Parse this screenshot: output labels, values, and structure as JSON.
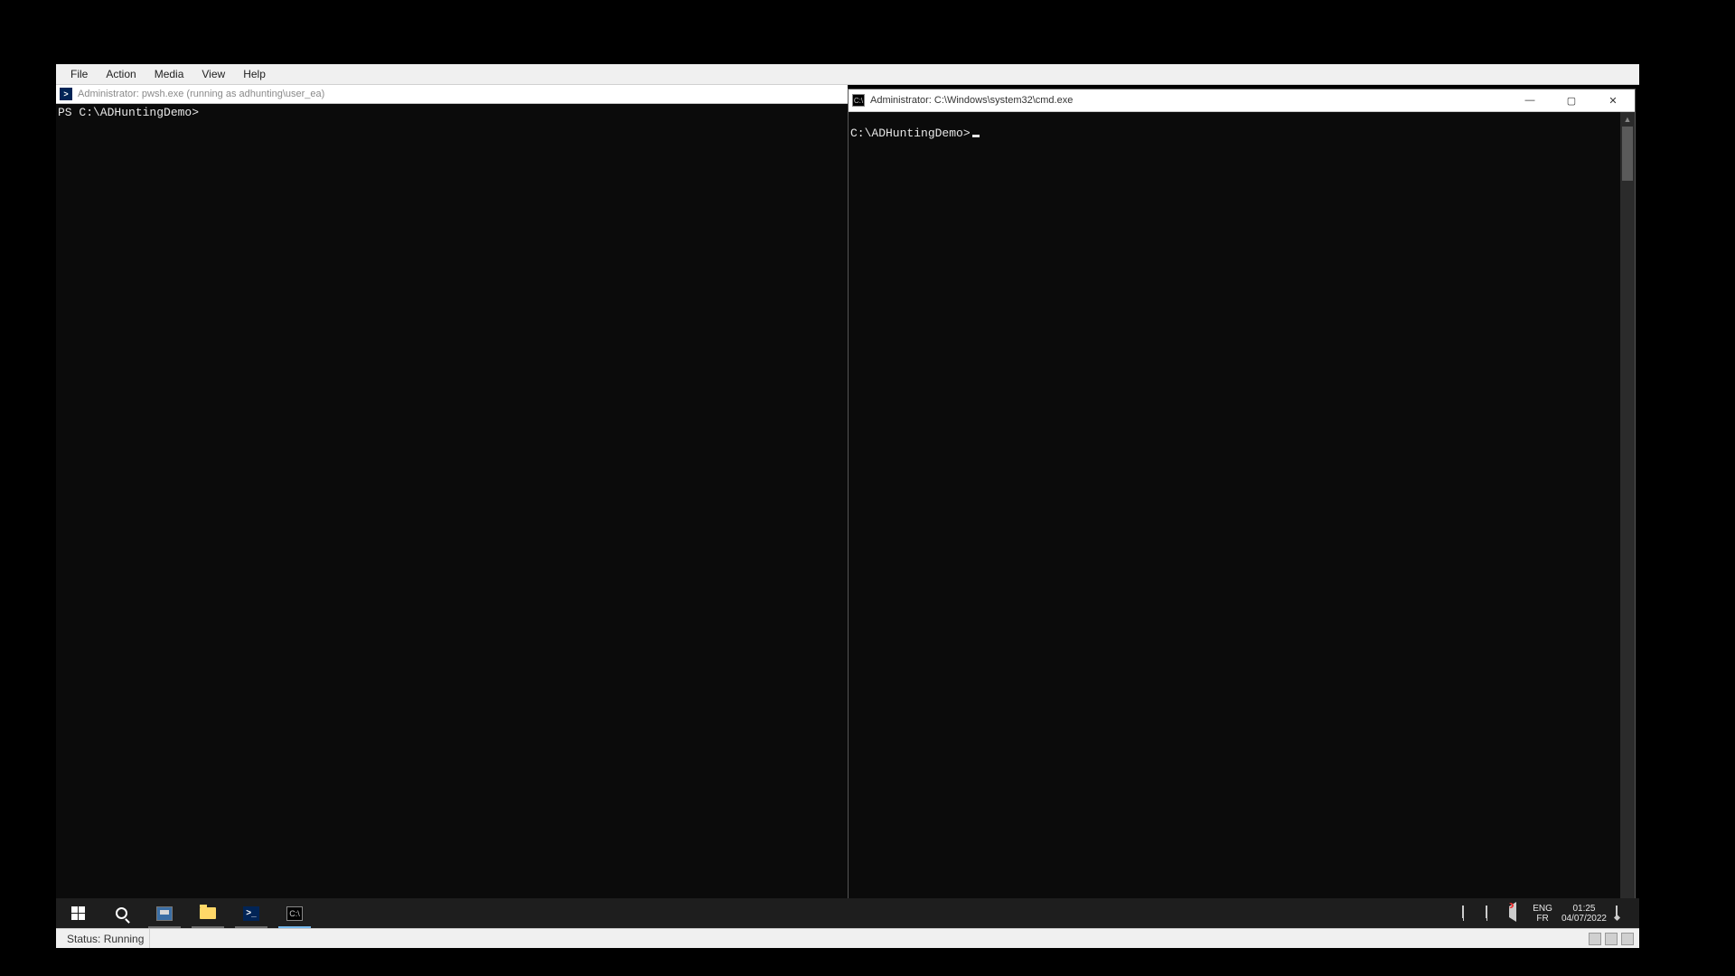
{
  "viewer": {
    "menu": [
      "File",
      "Action",
      "Media",
      "View",
      "Help"
    ],
    "status_label": "Status: Running"
  },
  "left_window": {
    "title": "Administrator: pwsh.exe (running as adhunting\\user_ea)",
    "prompt": "PS C:\\ADHuntingDemo>"
  },
  "right_window": {
    "title": "Administrator: C:\\Windows\\system32\\cmd.exe",
    "prompt": "C:\\ADHuntingDemo>",
    "controls": {
      "minimize": "—",
      "maximize": "▢",
      "close": "✕"
    }
  },
  "taskbar": {
    "buttons": [
      {
        "name": "start-button",
        "kind": "start"
      },
      {
        "name": "search-button",
        "kind": "search"
      },
      {
        "name": "server-manager-button",
        "kind": "srvmgr",
        "state": "running"
      },
      {
        "name": "file-explorer-button",
        "kind": "folder",
        "state": "running"
      },
      {
        "name": "powershell-button",
        "kind": "ps",
        "state": "running"
      },
      {
        "name": "cmd-button",
        "kind": "cmd",
        "state": "active"
      }
    ],
    "lang_top": "ENG",
    "lang_bottom": "FR",
    "time": "01:25",
    "date": "04/07/2022"
  }
}
